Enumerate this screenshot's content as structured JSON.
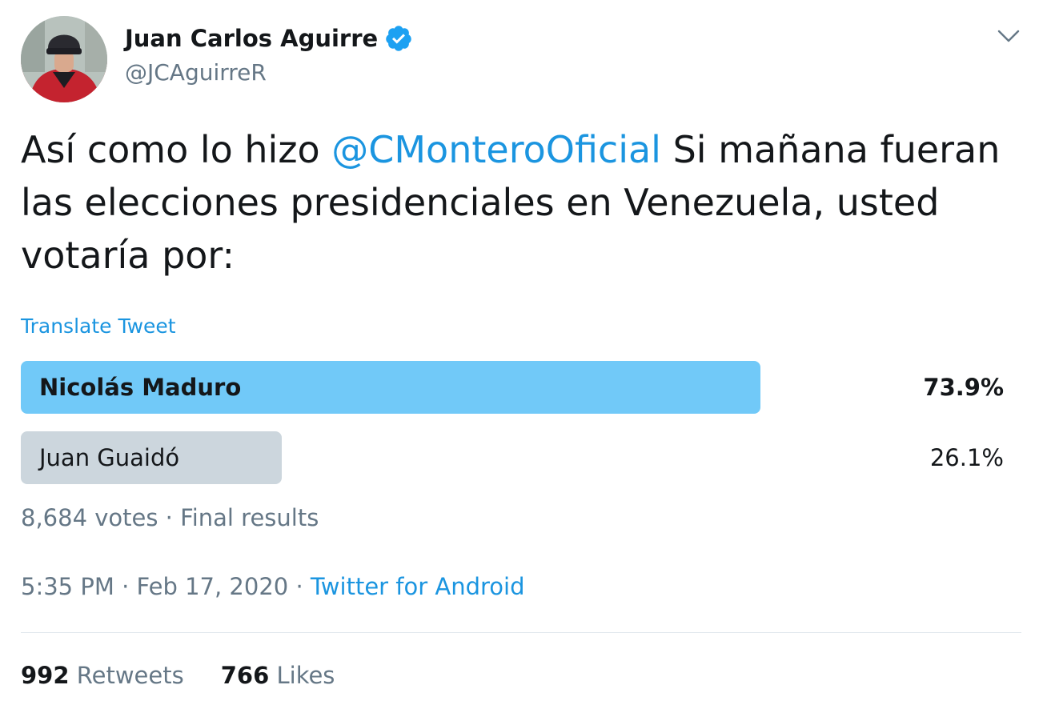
{
  "author": {
    "display_name": "Juan Carlos Aguirre",
    "handle": "@JCAguirreR",
    "verified_icon": "verified-badge-icon"
  },
  "tweet": {
    "text_before": "Así como lo hizo ",
    "mention": "@CMonteroOficial",
    "text_after": "  Si mañana fueran las elecciones presidenciales en Venezuela, usted votaría por:",
    "translate_label": "Translate Tweet"
  },
  "poll": {
    "options": [
      {
        "label": "Nicolás Maduro",
        "percent": "73.9%",
        "fraction": 0.739,
        "winner": true
      },
      {
        "label": "Juan Guaidó",
        "percent": "26.1%",
        "fraction": 0.261,
        "winner": false
      }
    ],
    "votes": "8,684 votes",
    "separator": " · ",
    "status": "Final results"
  },
  "meta": {
    "time": "5:35 PM",
    "separator": " · ",
    "date": "Feb 17, 2020",
    "source_separator": " · ",
    "source": "Twitter for Android"
  },
  "stats": {
    "retweets_count": "992",
    "retweets_label": " Retweets",
    "likes_count": "766",
    "likes_label": " Likes"
  },
  "colors": {
    "accent": "#1b95e0",
    "winner_bar": "#71c9f8",
    "loser_bar": "#ccd6dd",
    "secondary_text": "#657786"
  }
}
